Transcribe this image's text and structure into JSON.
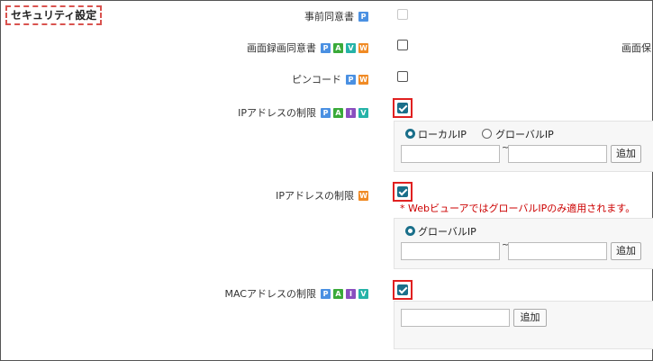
{
  "section_title": "セキュリティ設定",
  "badge_colors": {
    "P": "#4a90e2",
    "A": "#3aaa3a",
    "V": "#26b3a8",
    "W": "#f08a24",
    "I": "#8a4fbf"
  },
  "rows": [
    {
      "label": "事前同意書",
      "badges": [
        "P"
      ],
      "checked": false,
      "disabled": true
    },
    {
      "label": "画面録画同意書",
      "badges": [
        "P",
        "A",
        "V",
        "W"
      ],
      "checked": false,
      "disabled": false
    },
    {
      "label": "ピンコード",
      "badges": [
        "P",
        "W"
      ],
      "checked": false,
      "disabled": false
    },
    {
      "label": "IPアドレスの制限",
      "badges": [
        "P",
        "A",
        "I",
        "V"
      ],
      "checked": true,
      "disabled": false
    },
    {
      "label": "IPアドレスの制限",
      "badges": [
        "W"
      ],
      "checked": true,
      "disabled": false
    },
    {
      "label": "MACアドレスの制限",
      "badges": [
        "P",
        "A",
        "I",
        "V"
      ],
      "checked": true,
      "disabled": false
    }
  ],
  "cut_off_label": "画面保",
  "ip_panel_1": {
    "radio_local": "ローカルIP",
    "radio_global": "グローバルIP",
    "selected": "local",
    "tilde": "~",
    "add_button": "追加"
  },
  "web_note": "* WebビューアではグローバルIPのみ適用されます。",
  "ip_panel_2": {
    "radio_global": "グローバルIP",
    "tilde": "~",
    "add_button": "追加"
  },
  "mac_panel": {
    "add_button": "追加"
  }
}
